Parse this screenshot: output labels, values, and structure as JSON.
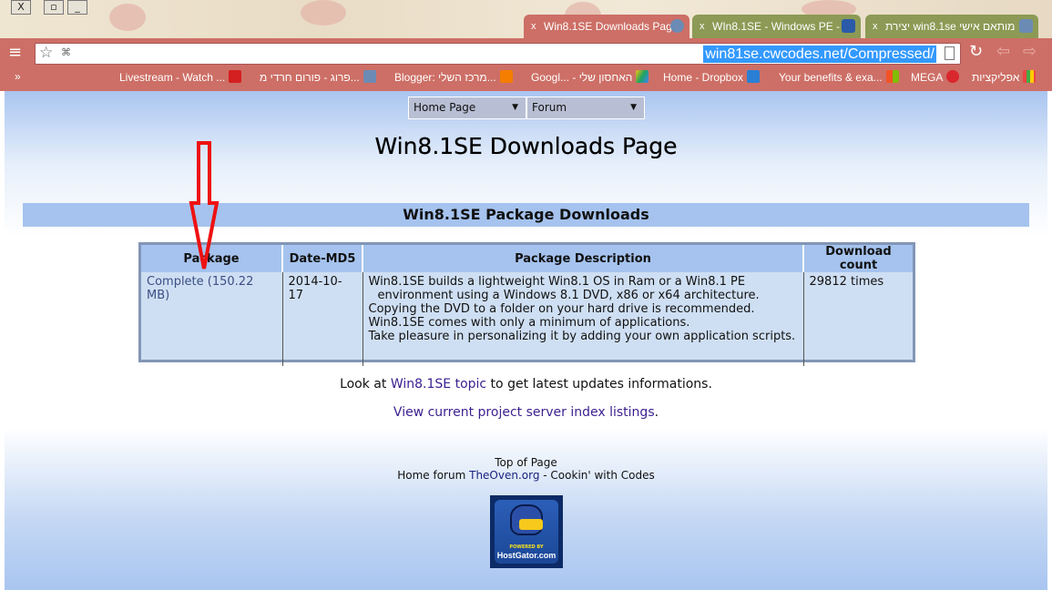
{
  "browser": {
    "tabs": [
      {
        "label": "Win8.1SE Downloads Page",
        "active": true
      },
      {
        "label": "WIn8.1SE - Windows PE -",
        "active": false
      },
      {
        "label": "יצירת win8.1se מותאם אישי",
        "active": false
      }
    ],
    "url": "win81se.cwcodes.net/Compressed/",
    "bookmarks": [
      "Livestream - Watch ...",
      "פרוג - פורום חרדי מ...",
      "Blogger: מרכז השלי...",
      "Googl... - האחסון שלי",
      "Home - Dropbox",
      "Your benefits & exa...",
      "MEGA",
      "אפליקציות"
    ],
    "overflow": "»"
  },
  "nav": {
    "home": "Home Page",
    "forum": "Forum"
  },
  "title": "Win8.1SE Downloads Page",
  "section": "Win8.1SE Package Downloads",
  "table": {
    "headers": [
      "Package",
      "Date-MD5",
      "Package Description",
      "Download count"
    ],
    "row": {
      "package": "Complete (150.22 MB)",
      "date": "2014-10-17",
      "description": [
        "Win8.1SE builds a lightweight Win8.1 OS in Ram or a Win8.1 PE",
        "environment using a Windows 8.1 DVD, x86 or x64 architecture.",
        "Copying the DVD to a folder on your hard drive is recommended.",
        "Win8.1SE comes with only a minimum of applications.",
        "Take pleasure in personalizing it by adding your own application scripts."
      ],
      "count": "29812 times"
    }
  },
  "info": {
    "pre": "Look at ",
    "link": "Win8.1SE topic",
    "post": " to get latest updates informations."
  },
  "listing": "View current project server index listings",
  "listing_post": ".",
  "footer": {
    "top": "Top of Page",
    "home_pre": "Home forum ",
    "home_link": "TheOven.org",
    "home_post": " - Cookin' with Codes"
  },
  "badge": {
    "line1": "POWERED BY",
    "line2": "HostGator.com"
  }
}
